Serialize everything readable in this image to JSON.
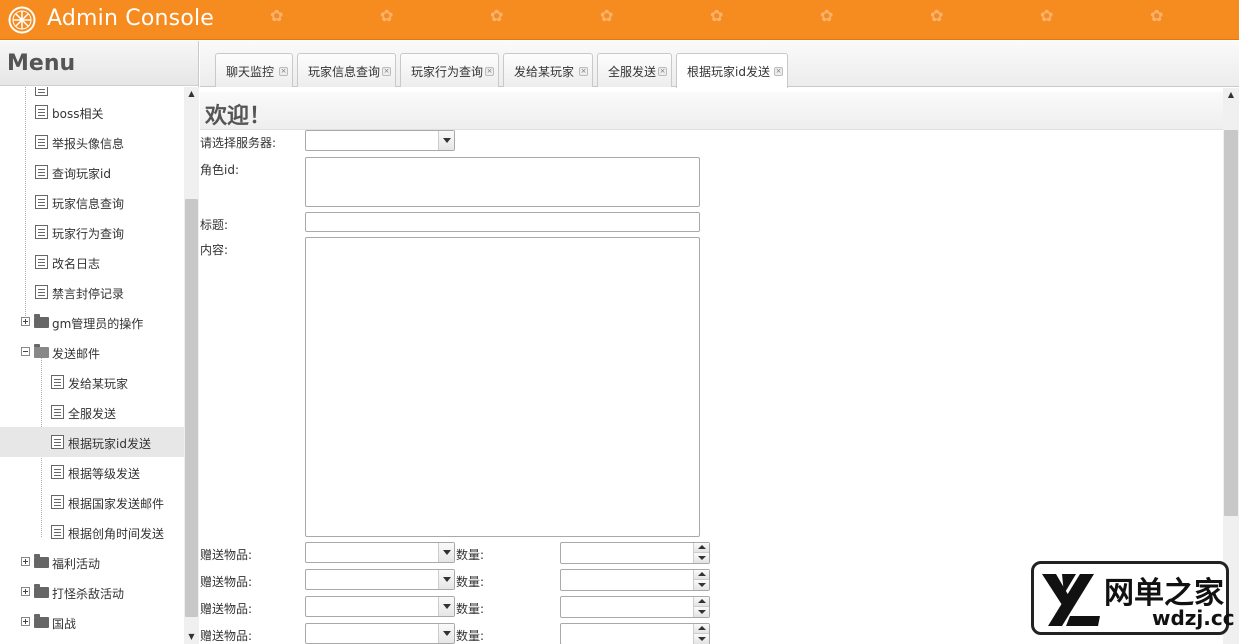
{
  "app": {
    "title": "Admin Console"
  },
  "sidebar": {
    "title": "Menu",
    "items": [
      {
        "label": "boss相关"
      },
      {
        "label": "举报头像信息"
      },
      {
        "label": "查询玩家id"
      },
      {
        "label": "玩家信息查询"
      },
      {
        "label": "玩家行为查询"
      },
      {
        "label": "改名日志"
      },
      {
        "label": "禁言封停记录"
      },
      {
        "label": "gm管理员的操作"
      },
      {
        "label": "发送邮件"
      },
      {
        "label": "发给某玩家"
      },
      {
        "label": "全服发送"
      },
      {
        "label": "根据玩家id发送"
      },
      {
        "label": "根据等级发送"
      },
      {
        "label": "根据国家发送邮件"
      },
      {
        "label": "根据创角时间发送"
      },
      {
        "label": "福利活动"
      },
      {
        "label": "打怪杀敌活动"
      },
      {
        "label": "国战"
      }
    ]
  },
  "tabs": [
    {
      "label": "聊天监控"
    },
    {
      "label": "玩家信息查询"
    },
    {
      "label": "玩家行为查询"
    },
    {
      "label": "发给某玩家"
    },
    {
      "label": "全服发送"
    },
    {
      "label": "根据玩家id发送"
    }
  ],
  "content": {
    "welcome": "欢迎！",
    "form": {
      "server_label": "请选择服务器:",
      "server_value": "",
      "role_id_label": "角色id:",
      "role_id_value": "",
      "title_label": "标题:",
      "title_value": "",
      "body_label": "内容:",
      "body_value": "",
      "gift_label": "赠送物品:",
      "qty_label": "数量:",
      "gift_rows": [
        {
          "item": "",
          "qty": ""
        },
        {
          "item": "",
          "qty": ""
        },
        {
          "item": "",
          "qty": ""
        },
        {
          "item": "",
          "qty": ""
        }
      ]
    }
  },
  "watermark": {
    "name": "网单之家",
    "site": "wdzj.cc"
  },
  "colors": {
    "header": "#f68b1f",
    "selected_row": "#e7e7e7",
    "border": "#c9c9c9"
  }
}
